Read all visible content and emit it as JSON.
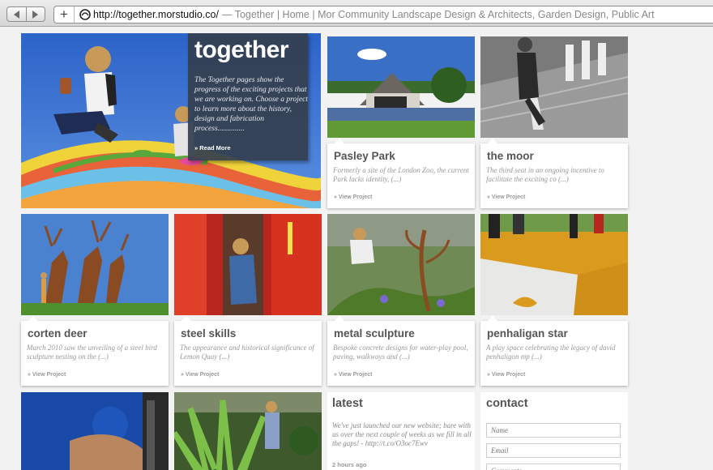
{
  "browser": {
    "url": "http://together.morstudio.co/",
    "title": "— Together | Home | Mor Community Landscape Design & Architects, Garden Design, Public Art"
  },
  "hero": {
    "title": "together",
    "text": "The Together pages show the progress of the exciting projects that we are working on. Choose a project to learn more about the history, design and fabrication process..............",
    "read_more": "» Read More"
  },
  "projects": [
    {
      "title": "Pasley Park",
      "desc": "Formerly a site of the London Zoo, the current Park lacks identity,  (...)",
      "link": "» View Project"
    },
    {
      "title": "the moor",
      "desc": "The third seat in an ongoing incentive to facilitate the exciting co  (...)",
      "link": "» View Project"
    },
    {
      "title": "corten deer",
      "desc": "March 2010 saw the unveiling of a steel bird sculpture nesting on the  (...)",
      "link": "» View Project"
    },
    {
      "title": "steel skills",
      "desc": "The appearance and historical significance of Lemon Quay  (...)",
      "link": "» View Project"
    },
    {
      "title": "metal sculpture",
      "desc": "Bespoke concrete designs for water-play pool, paving, walkways and  (...)",
      "link": "» View Project"
    },
    {
      "title": "penhaligan star",
      "desc": "A play space celebrating the legacy of david penhaligon mp  (...)",
      "link": "» View Project"
    }
  ],
  "latest": {
    "heading": "latest",
    "text": "We've just launched our new website; bare with us over the next couple of weeks as we fill in all the gaps! - http://t.co/O3oc7Ewv",
    "time": "2 hours ago"
  },
  "contact": {
    "heading": "contact",
    "name_placeholder": "Name",
    "email_placeholder": "Email",
    "comments_placeholder": "Comments"
  }
}
